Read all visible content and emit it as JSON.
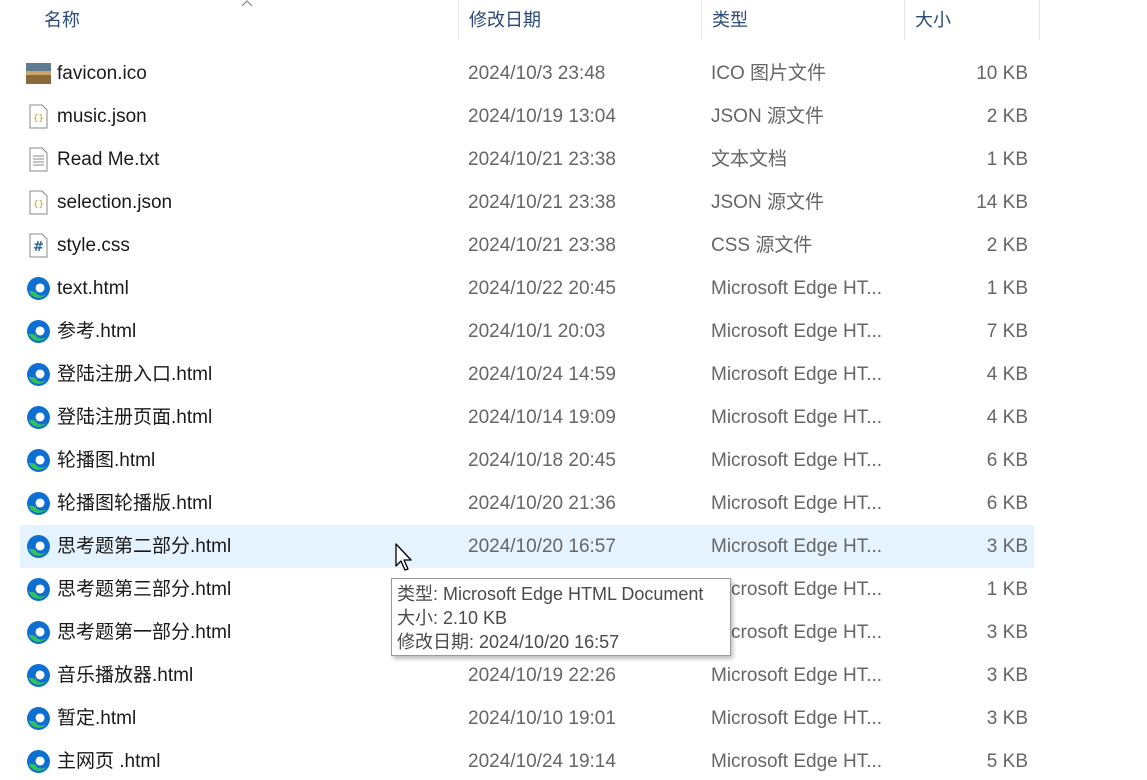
{
  "header": {
    "name": "名称",
    "date": "修改日期",
    "type": "类型",
    "size": "大小"
  },
  "files": [
    {
      "name": "favicon.ico",
      "date": "2024/10/3 23:48",
      "type": "ICO 图片文件",
      "size": "10 KB",
      "icon": "image-icon"
    },
    {
      "name": "music.json",
      "date": "2024/10/19 13:04",
      "type": "JSON 源文件",
      "size": "2 KB",
      "icon": "json-file-icon"
    },
    {
      "name": "Read Me.txt",
      "date": "2024/10/21 23:38",
      "type": "文本文档",
      "size": "1 KB",
      "icon": "text-file-icon"
    },
    {
      "name": "selection.json",
      "date": "2024/10/21 23:38",
      "type": "JSON 源文件",
      "size": "14 KB",
      "icon": "json-file-icon"
    },
    {
      "name": "style.css",
      "date": "2024/10/21 23:38",
      "type": "CSS 源文件",
      "size": "2 KB",
      "icon": "css-file-icon"
    },
    {
      "name": "text.html",
      "date": "2024/10/22 20:45",
      "type": "Microsoft Edge HT...",
      "size": "1 KB",
      "icon": "edge-icon"
    },
    {
      "name": "参考.html",
      "date": "2024/10/1 20:03",
      "type": "Microsoft Edge HT...",
      "size": "7 KB",
      "icon": "edge-icon"
    },
    {
      "name": "登陆注册入口.html",
      "date": "2024/10/24 14:59",
      "type": "Microsoft Edge HT...",
      "size": "4 KB",
      "icon": "edge-icon"
    },
    {
      "name": "登陆注册页面.html",
      "date": "2024/10/14 19:09",
      "type": "Microsoft Edge HT...",
      "size": "4 KB",
      "icon": "edge-icon"
    },
    {
      "name": "轮播图.html",
      "date": "2024/10/18 20:45",
      "type": "Microsoft Edge HT...",
      "size": "6 KB",
      "icon": "edge-icon"
    },
    {
      "name": "轮播图轮播版.html",
      "date": "2024/10/20 21:36",
      "type": "Microsoft Edge HT...",
      "size": "6 KB",
      "icon": "edge-icon"
    },
    {
      "name": "思考题第二部分.html",
      "date": "2024/10/20 16:57",
      "type": "Microsoft Edge HT...",
      "size": "3 KB",
      "icon": "edge-icon",
      "hover": true
    },
    {
      "name": "思考题第三部分.html",
      "date": "",
      "type": "Microsoft Edge HT...",
      "size": "1 KB",
      "icon": "edge-icon"
    },
    {
      "name": "思考题第一部分.html",
      "date": "",
      "type": "Microsoft Edge HT...",
      "size": "3 KB",
      "icon": "edge-icon"
    },
    {
      "name": "音乐播放器.html",
      "date": "2024/10/19 22:26",
      "type": "Microsoft Edge HT...",
      "size": "3 KB",
      "icon": "edge-icon"
    },
    {
      "name": "暂定.html",
      "date": "2024/10/10 19:01",
      "type": "Microsoft Edge HT...",
      "size": "3 KB",
      "icon": "edge-icon"
    },
    {
      "name": "主网页 .html",
      "date": "2024/10/24 19:14",
      "type": "Microsoft Edge HT...",
      "size": "5 KB",
      "icon": "edge-icon"
    }
  ],
  "tooltip": {
    "type_line": "类型: Microsoft Edge HTML Document",
    "size_line": "大小: 2.10 KB",
    "date_line": "修改日期: 2024/10/20 16:57"
  },
  "colors": {
    "hover_row": "#e5f3ff",
    "header_text": "#2b4a7a",
    "edge_blue": "#0c6fd1",
    "edge_green": "#35c159"
  }
}
